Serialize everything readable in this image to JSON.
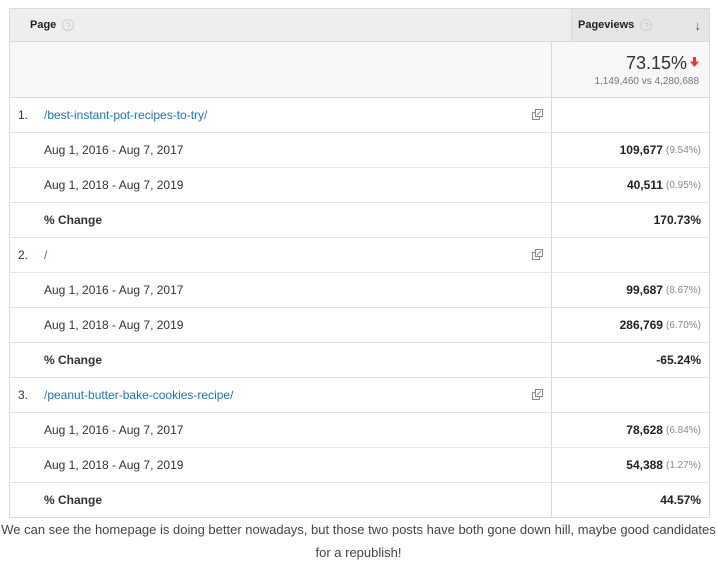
{
  "header": {
    "page_label": "Page",
    "pageviews_label": "Pageviews",
    "help_glyph": "?",
    "sort_glyph": "↓"
  },
  "summary": {
    "total": "73.15%",
    "comparison": "1,149,460 vs 4,280,688"
  },
  "rows": [
    {
      "index": "1.",
      "path": "/best-instant-pot-recipes-to-try/",
      "period1": {
        "label": "Aug 1, 2016 - Aug 7, 2017",
        "value": "109,677",
        "pct": "(9.54%)"
      },
      "period2": {
        "label": "Aug 1, 2018 - Aug 7, 2019",
        "value": "40,511",
        "pct": "(0.95%)"
      },
      "change": {
        "label": "% Change",
        "value": "170.73%"
      }
    },
    {
      "index": "2.",
      "path": "/",
      "period1": {
        "label": "Aug 1, 2016 - Aug 7, 2017",
        "value": "99,687",
        "pct": "(8.67%)"
      },
      "period2": {
        "label": "Aug 1, 2018 - Aug 7, 2019",
        "value": "286,769",
        "pct": "(6.70%)"
      },
      "change": {
        "label": "% Change",
        "value": "-65.24%"
      }
    },
    {
      "index": "3.",
      "path": "/peanut-butter-bake-cookies-recipe/",
      "period1": {
        "label": "Aug 1, 2016 - Aug 7, 2017",
        "value": "78,628",
        "pct": "(6.84%)"
      },
      "period2": {
        "label": "Aug 1, 2018 - Aug 7, 2019",
        "value": "54,388",
        "pct": "(1.27%)"
      },
      "change": {
        "label": "% Change",
        "value": "44.57%"
      }
    }
  ],
  "caption": "We can see the homepage is doing better nowadays, but those two posts have both gone down hill, maybe good candidates for a republish!",
  "colors": {
    "link": "#1a73c4",
    "decline": "#e53935",
    "header_bg": "#eeeeee"
  },
  "icons": {
    "external": "open-in-new-window-icon",
    "trend": "down-arrow-icon"
  }
}
